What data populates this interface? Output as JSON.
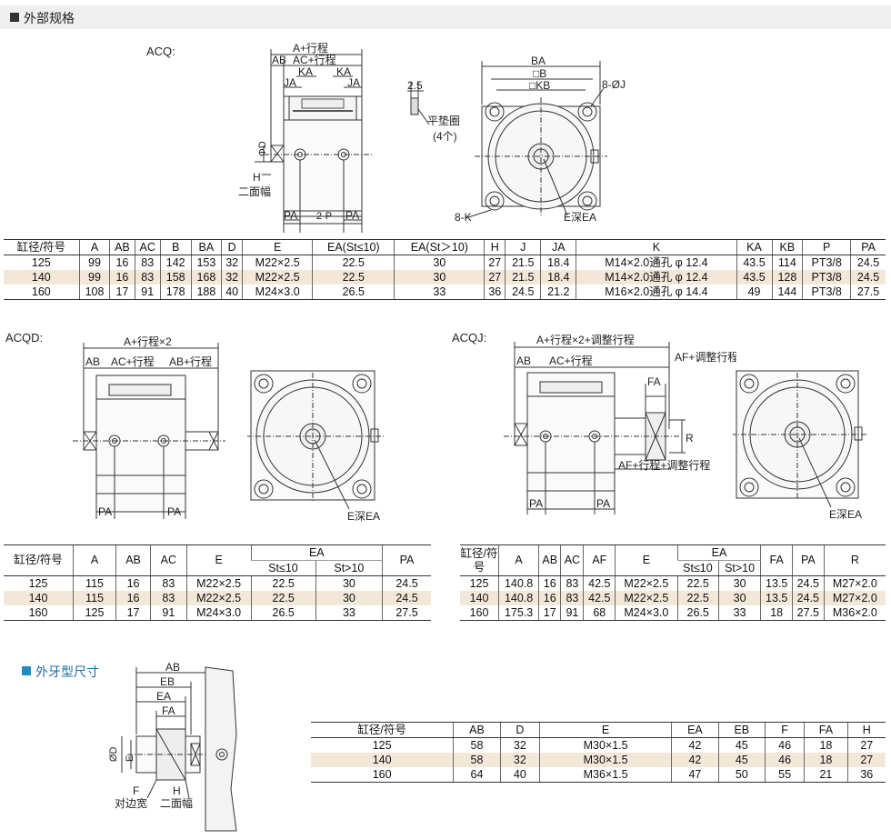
{
  "section_title": "外部规格",
  "section2_title": "外牙型尺寸",
  "labels": {
    "acq": "ACQ:",
    "acqd": "ACQD:",
    "acqj": "ACQJ:"
  },
  "acq_drawing": {
    "a_stroke": "A+行程",
    "ab": "AB",
    "ac_stroke": "AC+行程",
    "ka1": "KA",
    "ka2": "KA",
    "ja1": "JA",
    "ja2": "JA",
    "phid": "ΦD",
    "h": "H",
    "flats": "二面幅",
    "pa1": "PA",
    "two_p": "2-P",
    "pa2": "PA",
    "shim_thk": "2.5",
    "shim": "平垫圈",
    "shim_count": "(4个)",
    "ba": "BA",
    "b": "□B",
    "kb": "□KB",
    "j8": "8-ØJ",
    "k8": "8-K",
    "e_depth": "E深EA"
  },
  "acqd_drawing": {
    "a_stroke2": "A+行程×2",
    "ab": "AB",
    "ac_stroke": "AC+行程",
    "ab_stroke": "AB+行程",
    "pa1": "PA",
    "pa2": "PA",
    "e_depth": "E深EA"
  },
  "acqj_drawing": {
    "a_adj": "A+行程×2+调整行程",
    "ab": "AB",
    "ac_stroke": "AC+行程",
    "af_adj": "AF+调整行程",
    "fa": "FA",
    "r": "R",
    "af_stroke_adj": "AF+行程+调整行程",
    "pa1": "PA",
    "pa2": "PA",
    "e_depth": "E深EA"
  },
  "thread_drawing": {
    "ab": "AB",
    "eb": "EB",
    "ea": "EA",
    "fa": "FA",
    "od": "ØD",
    "e": "E",
    "f": "F",
    "h": "H",
    "across": "对边宽",
    "flats": "二面幅"
  },
  "table1": {
    "headers": [
      "缸径/符号",
      "A",
      "AB",
      "AC",
      "B",
      "BA",
      "D",
      "E",
      "EA(St≤10)",
      "EA(St＞10)",
      "H",
      "J",
      "JA",
      "K",
      "KA",
      "KB",
      "P",
      "PA"
    ],
    "rows": [
      [
        "125",
        "99",
        "16",
        "83",
        "142",
        "153",
        "32",
        "M22×2.5",
        "22.5",
        "30",
        "27",
        "21.5",
        "18.4",
        "M14×2.0通孔 φ 12.4",
        "43.5",
        "114",
        "PT3/8",
        "24.5"
      ],
      [
        "140",
        "99",
        "16",
        "83",
        "158",
        "168",
        "32",
        "M22×2.5",
        "22.5",
        "30",
        "27",
        "21.5",
        "18.4",
        "M14×2.0通孔 φ 12.4",
        "43.5",
        "128",
        "PT3/8",
        "24.5"
      ],
      [
        "160",
        "108",
        "17",
        "91",
        "178",
        "188",
        "40",
        "M24×3.0",
        "26.5",
        "33",
        "36",
        "24.5",
        "21.2",
        "M16×2.0通孔 φ 14.4",
        "49",
        "144",
        "PT3/8",
        "27.5"
      ]
    ]
  },
  "table2": {
    "headers": [
      "缸径/符号",
      "A",
      "AB",
      "AC",
      "E",
      "EA",
      "PA"
    ],
    "sub": [
      "St≤10",
      "St>10"
    ],
    "rows": [
      [
        "125",
        "115",
        "16",
        "83",
        "M22×2.5",
        "22.5",
        "30",
        "24.5"
      ],
      [
        "140",
        "115",
        "16",
        "83",
        "M22×2.5",
        "22.5",
        "30",
        "24.5"
      ],
      [
        "160",
        "125",
        "17",
        "91",
        "M24×3.0",
        "26.5",
        "33",
        "27.5"
      ]
    ]
  },
  "table3": {
    "headers": [
      "缸径/符号",
      "A",
      "AB",
      "AC",
      "AF",
      "E",
      "EA",
      "FA",
      "PA",
      "R"
    ],
    "sub": [
      "St≤10",
      "St>10"
    ],
    "rows": [
      [
        "125",
        "140.8",
        "16",
        "83",
        "42.5",
        "M22×2.5",
        "22.5",
        "30",
        "13.5",
        "24.5",
        "M27×2.0"
      ],
      [
        "140",
        "140.8",
        "16",
        "83",
        "42.5",
        "M22×2.5",
        "22.5",
        "30",
        "13.5",
        "24.5",
        "M27×2.0"
      ],
      [
        "160",
        "175.3",
        "17",
        "91",
        "68",
        "M24×3.0",
        "26.5",
        "33",
        "18",
        "27.5",
        "M36×2.0"
      ]
    ]
  },
  "table4": {
    "headers": [
      "缸径/符号",
      "AB",
      "D",
      "E",
      "EA",
      "EB",
      "F",
      "FA",
      "H"
    ],
    "rows": [
      [
        "125",
        "58",
        "32",
        "M30×1.5",
        "42",
        "45",
        "46",
        "18",
        "27"
      ],
      [
        "140",
        "58",
        "32",
        "M30×1.5",
        "42",
        "45",
        "46",
        "18",
        "27"
      ],
      [
        "160",
        "64",
        "40",
        "M36×1.5",
        "47",
        "50",
        "55",
        "21",
        "36"
      ]
    ]
  },
  "colors": {
    "highlight_row": "#f3e8d8",
    "header_bar": "#efefef",
    "section2_accent": "#1c8fc0"
  }
}
